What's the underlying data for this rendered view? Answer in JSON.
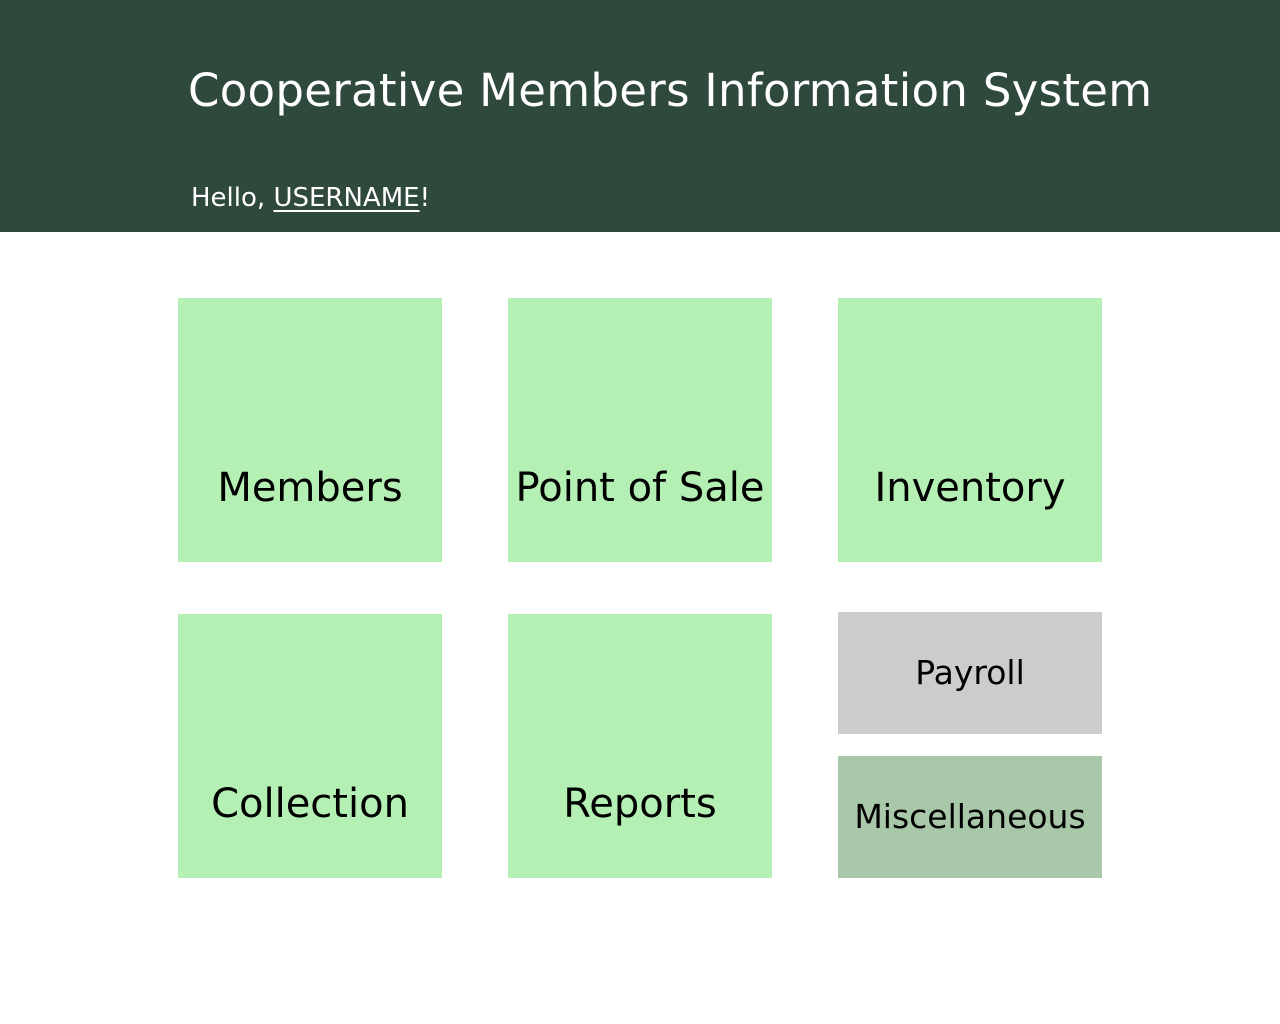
{
  "header": {
    "title": "Cooperative Members Information System",
    "greeting_prefix": "Hello, ",
    "username": "USERNAME",
    "greeting_suffix": "!"
  },
  "tiles": {
    "members": "Members",
    "point_of_sale": "Point of Sale",
    "inventory": "Inventory",
    "collection": "Collection",
    "reports": "Reports",
    "payroll": "Payroll",
    "miscellaneous": "Miscellaneous"
  },
  "colors": {
    "header_background": "#30493d",
    "tile_green": "#b4efb4",
    "tile_gray": "#cccccc",
    "tile_muted_green": "#a9c8a9"
  }
}
